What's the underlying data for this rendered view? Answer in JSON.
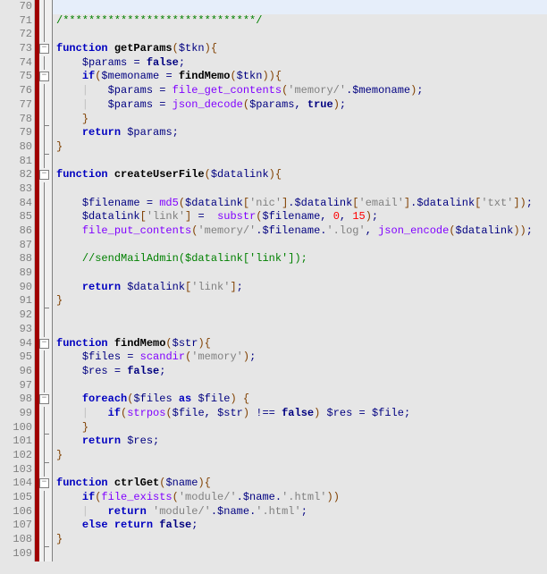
{
  "lines": {
    "70": {
      "num": "70",
      "fold": "vline",
      "tokens": []
    },
    "71": {
      "num": "71",
      "fold": "vline",
      "tokens": [
        [
          "comment",
          "/******************************/"
        ]
      ]
    },
    "72": {
      "num": "72",
      "fold": "vline",
      "tokens": []
    },
    "73": {
      "num": "73",
      "fold": "box",
      "tokens": [
        [
          "kw",
          "function"
        ],
        [
          "normal",
          " "
        ],
        [
          "fn",
          "getParams"
        ],
        [
          "brown",
          "("
        ],
        [
          "var",
          "$tkn"
        ],
        [
          "brown",
          ")"
        ],
        [
          "brown",
          "{"
        ]
      ]
    },
    "74": {
      "num": "74",
      "fold": "vline",
      "tokens": [
        [
          "normal",
          "    "
        ],
        [
          "var",
          "$params"
        ],
        [
          "normal",
          " "
        ],
        [
          "op",
          "="
        ],
        [
          "normal",
          " "
        ],
        [
          "bool",
          "false"
        ],
        [
          "op",
          ";"
        ]
      ]
    },
    "75": {
      "num": "75",
      "fold": "box",
      "tokens": [
        [
          "normal",
          "    "
        ],
        [
          "kw",
          "if"
        ],
        [
          "brown",
          "("
        ],
        [
          "var",
          "$memoname"
        ],
        [
          "normal",
          " "
        ],
        [
          "op",
          "="
        ],
        [
          "normal",
          " "
        ],
        [
          "fn",
          "findMemo"
        ],
        [
          "brown",
          "("
        ],
        [
          "var",
          "$tkn"
        ],
        [
          "brown",
          "))"
        ],
        [
          "brown",
          "{"
        ]
      ]
    },
    "76": {
      "num": "76",
      "fold": "vline",
      "tokens": [
        [
          "guide",
          "    |   "
        ],
        [
          "var",
          "$params"
        ],
        [
          "normal",
          " "
        ],
        [
          "op",
          "="
        ],
        [
          "normal",
          " "
        ],
        [
          "builtin",
          "file_get_contents"
        ],
        [
          "brown",
          "("
        ],
        [
          "str",
          "'memory/'"
        ],
        [
          "op",
          "."
        ],
        [
          "var",
          "$memoname"
        ],
        [
          "brown",
          ")"
        ],
        [
          "op",
          ";"
        ]
      ]
    },
    "77": {
      "num": "77",
      "fold": "vline",
      "tokens": [
        [
          "guide",
          "    |   "
        ],
        [
          "var",
          "$params"
        ],
        [
          "normal",
          " "
        ],
        [
          "op",
          "="
        ],
        [
          "normal",
          " "
        ],
        [
          "builtin",
          "json_decode"
        ],
        [
          "brown",
          "("
        ],
        [
          "var",
          "$params"
        ],
        [
          "op",
          ","
        ],
        [
          "normal",
          " "
        ],
        [
          "bool",
          "true"
        ],
        [
          "brown",
          ")"
        ],
        [
          "op",
          ";"
        ]
      ]
    },
    "78": {
      "num": "78",
      "fold": "vlend",
      "tokens": [
        [
          "normal",
          "    "
        ],
        [
          "brown",
          "}"
        ]
      ]
    },
    "79": {
      "num": "79",
      "fold": "vline",
      "tokens": [
        [
          "normal",
          "    "
        ],
        [
          "kw",
          "return"
        ],
        [
          "normal",
          " "
        ],
        [
          "var",
          "$params"
        ],
        [
          "op",
          ";"
        ]
      ]
    },
    "80": {
      "num": "80",
      "fold": "vlend",
      "tokens": [
        [
          "brown",
          "}"
        ]
      ]
    },
    "81": {
      "num": "81",
      "fold": "vline",
      "tokens": []
    },
    "82": {
      "num": "82",
      "fold": "box",
      "tokens": [
        [
          "kw",
          "function"
        ],
        [
          "normal",
          " "
        ],
        [
          "fn",
          "createUserFile"
        ],
        [
          "brown",
          "("
        ],
        [
          "var",
          "$datalink"
        ],
        [
          "brown",
          ")"
        ],
        [
          "brown",
          "{"
        ]
      ]
    },
    "83": {
      "num": "83",
      "fold": "vline",
      "tokens": []
    },
    "84": {
      "num": "84",
      "fold": "vline",
      "tokens": [
        [
          "normal",
          "    "
        ],
        [
          "var",
          "$filename"
        ],
        [
          "normal",
          " "
        ],
        [
          "op",
          "="
        ],
        [
          "normal",
          " "
        ],
        [
          "builtin",
          "md5"
        ],
        [
          "brown",
          "("
        ],
        [
          "var",
          "$datalink"
        ],
        [
          "brown",
          "["
        ],
        [
          "str",
          "'nic'"
        ],
        [
          "brown",
          "]"
        ],
        [
          "op",
          "."
        ],
        [
          "var",
          "$datalink"
        ],
        [
          "brown",
          "["
        ],
        [
          "str",
          "'email'"
        ],
        [
          "brown",
          "]"
        ],
        [
          "op",
          "."
        ],
        [
          "var",
          "$datalink"
        ],
        [
          "brown",
          "["
        ],
        [
          "str",
          "'txt'"
        ],
        [
          "brown",
          "])"
        ],
        [
          "op",
          ";"
        ]
      ]
    },
    "85": {
      "num": "85",
      "fold": "vline",
      "tokens": [
        [
          "normal",
          "    "
        ],
        [
          "var",
          "$datalink"
        ],
        [
          "brown",
          "["
        ],
        [
          "str",
          "'link'"
        ],
        [
          "brown",
          "]"
        ],
        [
          "normal",
          " "
        ],
        [
          "op",
          "="
        ],
        [
          "normal",
          "  "
        ],
        [
          "builtin",
          "substr"
        ],
        [
          "brown",
          "("
        ],
        [
          "var",
          "$filename"
        ],
        [
          "op",
          ","
        ],
        [
          "normal",
          " "
        ],
        [
          "num",
          "0"
        ],
        [
          "op",
          ","
        ],
        [
          "normal",
          " "
        ],
        [
          "num",
          "15"
        ],
        [
          "brown",
          ")"
        ],
        [
          "op",
          ";"
        ]
      ]
    },
    "86": {
      "num": "86",
      "fold": "vline",
      "tokens": [
        [
          "normal",
          "    "
        ],
        [
          "builtin",
          "file_put_contents"
        ],
        [
          "brown",
          "("
        ],
        [
          "str",
          "'memory/'"
        ],
        [
          "op",
          "."
        ],
        [
          "var",
          "$filename"
        ],
        [
          "op",
          "."
        ],
        [
          "str",
          "'.log'"
        ],
        [
          "op",
          ","
        ],
        [
          "normal",
          " "
        ],
        [
          "builtin",
          "json_encode"
        ],
        [
          "brown",
          "("
        ],
        [
          "var",
          "$datalink"
        ],
        [
          "brown",
          "))"
        ],
        [
          "op",
          ";"
        ]
      ]
    },
    "87": {
      "num": "87",
      "fold": "vline",
      "tokens": []
    },
    "88": {
      "num": "88",
      "fold": "vline",
      "tokens": [
        [
          "normal",
          "    "
        ],
        [
          "comment",
          "//sendMailAdmin($datalink['link']);"
        ]
      ]
    },
    "89": {
      "num": "89",
      "fold": "vline",
      "tokens": []
    },
    "90": {
      "num": "90",
      "fold": "vline",
      "tokens": [
        [
          "normal",
          "    "
        ],
        [
          "kw",
          "return"
        ],
        [
          "normal",
          " "
        ],
        [
          "var",
          "$datalink"
        ],
        [
          "brown",
          "["
        ],
        [
          "str",
          "'link'"
        ],
        [
          "brown",
          "]"
        ],
        [
          "op",
          ";"
        ]
      ]
    },
    "91": {
      "num": "91",
      "fold": "vlend",
      "tokens": [
        [
          "brown",
          "}"
        ]
      ]
    },
    "92": {
      "num": "92",
      "fold": "vline",
      "tokens": []
    },
    "93": {
      "num": "93",
      "fold": "vline",
      "tokens": []
    },
    "94": {
      "num": "94",
      "fold": "box",
      "tokens": [
        [
          "kw",
          "function"
        ],
        [
          "normal",
          " "
        ],
        [
          "fn",
          "findMemo"
        ],
        [
          "brown",
          "("
        ],
        [
          "var",
          "$str"
        ],
        [
          "brown",
          ")"
        ],
        [
          "brown",
          "{"
        ]
      ]
    },
    "95": {
      "num": "95",
      "fold": "vline",
      "tokens": [
        [
          "normal",
          "    "
        ],
        [
          "var",
          "$files"
        ],
        [
          "normal",
          " "
        ],
        [
          "op",
          "="
        ],
        [
          "normal",
          " "
        ],
        [
          "builtin",
          "scandir"
        ],
        [
          "brown",
          "("
        ],
        [
          "str",
          "'memory'"
        ],
        [
          "brown",
          ")"
        ],
        [
          "op",
          ";"
        ]
      ]
    },
    "96": {
      "num": "96",
      "fold": "vline",
      "tokens": [
        [
          "normal",
          "    "
        ],
        [
          "var",
          "$res"
        ],
        [
          "normal",
          " "
        ],
        [
          "op",
          "="
        ],
        [
          "normal",
          " "
        ],
        [
          "bool",
          "false"
        ],
        [
          "op",
          ";"
        ]
      ]
    },
    "97": {
      "num": "97",
      "fold": "vline",
      "tokens": []
    },
    "98": {
      "num": "98",
      "fold": "box",
      "tokens": [
        [
          "normal",
          "    "
        ],
        [
          "kw",
          "foreach"
        ],
        [
          "brown",
          "("
        ],
        [
          "var",
          "$files"
        ],
        [
          "normal",
          " "
        ],
        [
          "kw",
          "as"
        ],
        [
          "normal",
          " "
        ],
        [
          "var",
          "$file"
        ],
        [
          "brown",
          ")"
        ],
        [
          "normal",
          " "
        ],
        [
          "brown",
          "{"
        ]
      ]
    },
    "99": {
      "num": "99",
      "fold": "vline",
      "tokens": [
        [
          "guide",
          "    |   "
        ],
        [
          "kw",
          "if"
        ],
        [
          "brown",
          "("
        ],
        [
          "builtin",
          "strpos"
        ],
        [
          "brown",
          "("
        ],
        [
          "var",
          "$file"
        ],
        [
          "op",
          ","
        ],
        [
          "normal",
          " "
        ],
        [
          "var",
          "$str"
        ],
        [
          "brown",
          ")"
        ],
        [
          "normal",
          " "
        ],
        [
          "op",
          "!=="
        ],
        [
          "normal",
          " "
        ],
        [
          "bool",
          "false"
        ],
        [
          "brown",
          ")"
        ],
        [
          "normal",
          " "
        ],
        [
          "var",
          "$res"
        ],
        [
          "normal",
          " "
        ],
        [
          "op",
          "="
        ],
        [
          "normal",
          " "
        ],
        [
          "var",
          "$file"
        ],
        [
          "op",
          ";"
        ]
      ]
    },
    "100": {
      "num": "100",
      "fold": "vlend",
      "tokens": [
        [
          "normal",
          "    "
        ],
        [
          "brown",
          "}"
        ]
      ]
    },
    "101": {
      "num": "101",
      "fold": "vline",
      "tokens": [
        [
          "normal",
          "    "
        ],
        [
          "kw",
          "return"
        ],
        [
          "normal",
          " "
        ],
        [
          "var",
          "$res"
        ],
        [
          "op",
          ";"
        ]
      ]
    },
    "102": {
      "num": "102",
      "fold": "vlend",
      "tokens": [
        [
          "brown",
          "}"
        ]
      ]
    },
    "103": {
      "num": "103",
      "fold": "vline",
      "tokens": []
    },
    "104": {
      "num": "104",
      "fold": "box",
      "tokens": [
        [
          "kw",
          "function"
        ],
        [
          "normal",
          " "
        ],
        [
          "fn",
          "ctrlGet"
        ],
        [
          "brown",
          "("
        ],
        [
          "var",
          "$name"
        ],
        [
          "brown",
          ")"
        ],
        [
          "brown",
          "{"
        ]
      ]
    },
    "105": {
      "num": "105",
      "fold": "vline",
      "tokens": [
        [
          "normal",
          "    "
        ],
        [
          "kw",
          "if"
        ],
        [
          "brown",
          "("
        ],
        [
          "builtin",
          "file_exists"
        ],
        [
          "brown",
          "("
        ],
        [
          "str",
          "'module/'"
        ],
        [
          "op",
          "."
        ],
        [
          "var",
          "$name"
        ],
        [
          "op",
          "."
        ],
        [
          "str",
          "'.html'"
        ],
        [
          "brown",
          "))"
        ]
      ]
    },
    "106": {
      "num": "106",
      "fold": "vline",
      "tokens": [
        [
          "guide",
          "    |   "
        ],
        [
          "kw",
          "return"
        ],
        [
          "normal",
          " "
        ],
        [
          "str",
          "'module/'"
        ],
        [
          "op",
          "."
        ],
        [
          "var",
          "$name"
        ],
        [
          "op",
          "."
        ],
        [
          "str",
          "'.html'"
        ],
        [
          "op",
          ";"
        ]
      ]
    },
    "107": {
      "num": "107",
      "fold": "vline",
      "tokens": [
        [
          "normal",
          "    "
        ],
        [
          "kw",
          "else"
        ],
        [
          "normal",
          " "
        ],
        [
          "kw",
          "return"
        ],
        [
          "normal",
          " "
        ],
        [
          "bool",
          "false"
        ],
        [
          "op",
          ";"
        ]
      ]
    },
    "108": {
      "num": "108",
      "fold": "vlend",
      "tokens": [
        [
          "brown",
          "}"
        ]
      ]
    },
    "109": {
      "num": "109",
      "fold": "vline",
      "tokens": []
    }
  },
  "order": [
    "70",
    "71",
    "72",
    "73",
    "74",
    "75",
    "76",
    "77",
    "78",
    "79",
    "80",
    "81",
    "82",
    "83",
    "84",
    "85",
    "86",
    "87",
    "88",
    "89",
    "90",
    "91",
    "92",
    "93",
    "94",
    "95",
    "96",
    "97",
    "98",
    "99",
    "100",
    "101",
    "102",
    "103",
    "104",
    "105",
    "106",
    "107",
    "108",
    "109"
  ],
  "highlight": "70",
  "fold_symbol": "−"
}
